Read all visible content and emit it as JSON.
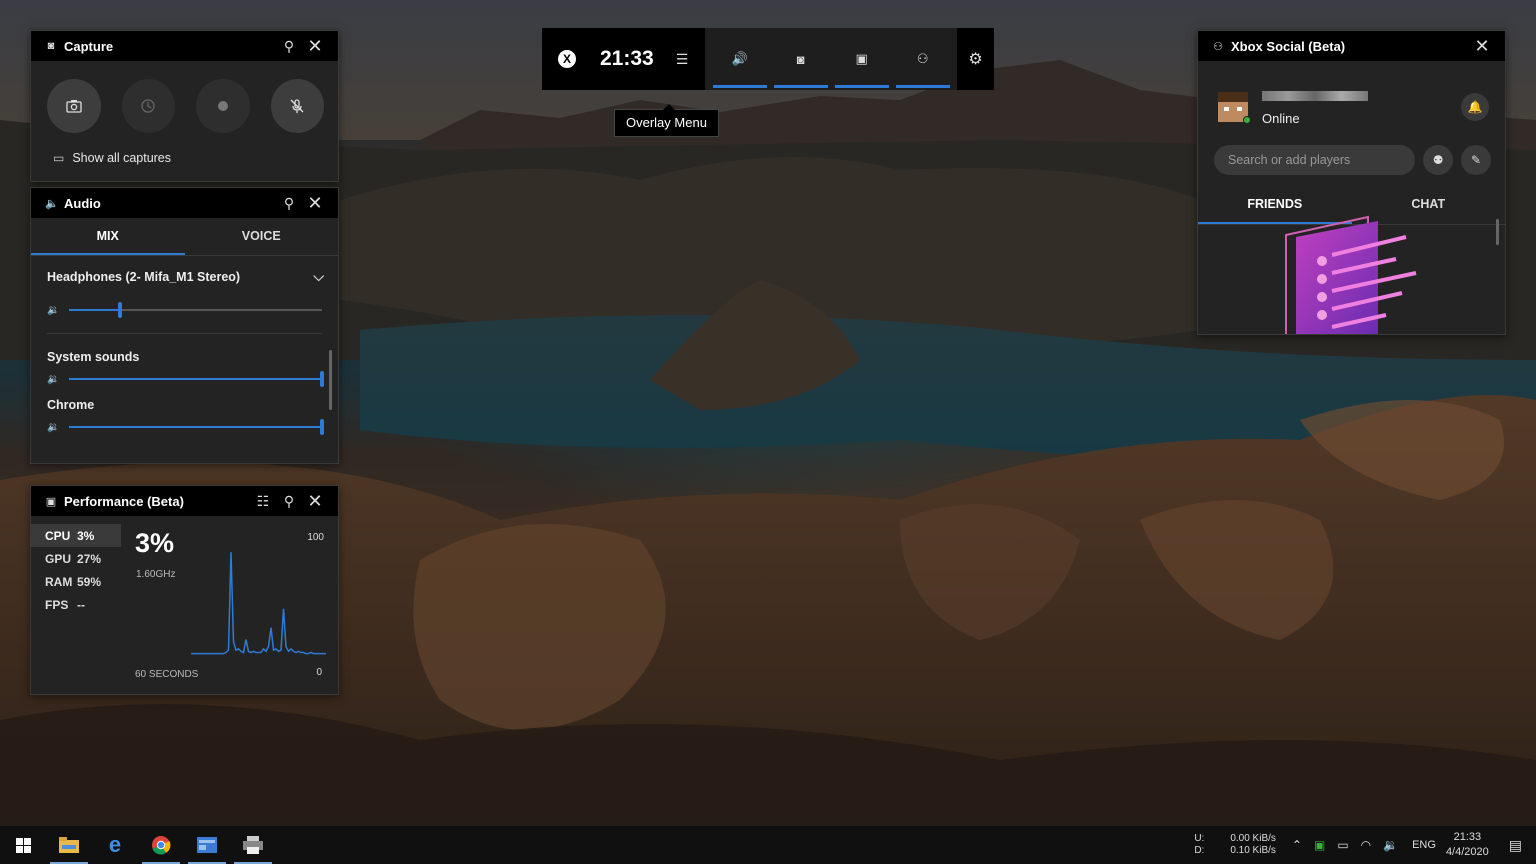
{
  "topbar": {
    "logo_glyph": "X",
    "time": "21:33",
    "menu_icon": "hamburger-icon",
    "buttons": [
      {
        "icon": "speaker-icon",
        "glyph": "🔊"
      },
      {
        "icon": "capture-icon",
        "glyph": "◙"
      },
      {
        "icon": "performance-icon",
        "glyph": "▣"
      },
      {
        "icon": "social-icon",
        "glyph": "⚇"
      }
    ],
    "settings_icon": "gear-icon",
    "tooltip": "Overlay Menu"
  },
  "capture": {
    "title": "Capture",
    "show_all_label": "Show all captures",
    "buttons": [
      "screenshot-icon",
      "record-last-icon",
      "record-icon",
      "mic-off-icon"
    ]
  },
  "audio": {
    "title": "Audio",
    "tabs": [
      "MIX",
      "VOICE"
    ],
    "active_tab": "MIX",
    "device": "Headphones (2- Mifa_M1 Stereo)",
    "device_volume": 0.2,
    "apps": [
      {
        "name": "System sounds",
        "volume": 1.0
      },
      {
        "name": "Chrome",
        "volume": 1.0
      }
    ]
  },
  "performance": {
    "title": "Performance (Beta)",
    "metrics": [
      {
        "key": "CPU",
        "value": "3%"
      },
      {
        "key": "GPU",
        "value": "27%"
      },
      {
        "key": "RAM",
        "value": "59%"
      },
      {
        "key": "FPS",
        "value": "--"
      }
    ],
    "big_value": "3%",
    "frequency": "1.60GHz",
    "axis_max": "100",
    "axis_min": "0",
    "window_label": "60 SECONDS",
    "series": [
      2,
      2,
      2,
      2,
      2,
      2,
      2,
      2,
      2,
      2,
      2,
      2,
      2,
      2,
      3,
      5,
      88,
      12,
      5,
      6,
      4,
      3,
      14,
      4,
      3,
      4,
      3,
      3,
      3,
      6,
      4,
      8,
      24,
      5,
      6,
      4,
      5,
      40,
      8,
      4,
      6,
      4,
      3,
      4,
      3,
      3,
      2,
      2,
      3,
      2,
      2,
      2,
      2,
      2,
      2
    ]
  },
  "social": {
    "title": "Xbox Social (Beta)",
    "status": "Online",
    "search_placeholder": "Search or add players",
    "tabs": [
      "FRIENDS",
      "CHAT"
    ],
    "active_tab": "FRIENDS"
  },
  "taskbar": {
    "apps": [
      "file-explorer-icon",
      "edge-icon",
      "chrome-icon",
      "app-icon",
      "printer-icon"
    ],
    "net_labels": [
      "U:",
      "D:"
    ],
    "upload": "0.00 KiB/s",
    "download": "0.10 KiB/s",
    "language": "ENG",
    "time": "21:33",
    "date": "4/4/2020"
  },
  "colors": {
    "accent": "#2e7bd6",
    "panel": "#232323",
    "header": "#000000",
    "online": "#3ab03a",
    "graph": "#2e7bd6"
  }
}
